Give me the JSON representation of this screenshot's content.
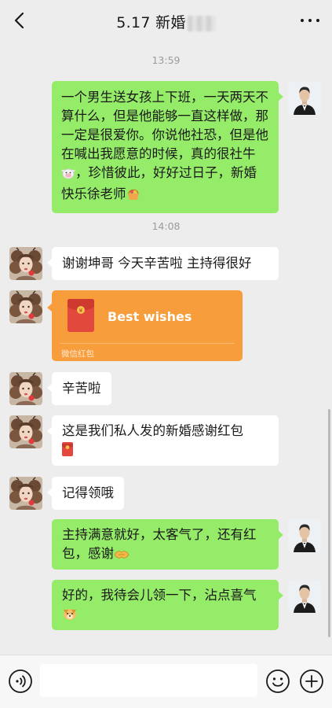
{
  "header": {
    "title": "5.17 新婚",
    "back_icon": "chevron-left-icon",
    "more_icon": "more-dots-icon"
  },
  "timestamps": [
    "13:59",
    "14:08"
  ],
  "messages": [
    {
      "sender": "me",
      "text": "一个男生送女孩上下班，一天两天不算什么，但是他能够一直这样做，那一定是很爱你。你说他社恐，但是他在喊出我愿意的时候，真的很社牛",
      "emoji": "cow-face-icon",
      "text2": "，珍惜彼此，好好过日子，新婚快乐徐老师",
      "emoji2": "gift-basket-icon"
    },
    {
      "sender": "them",
      "text": "谢谢坤哥 今天辛苦啦 主持得很好"
    },
    {
      "sender": "them",
      "type": "red_packet",
      "title": "Best wishes",
      "footer": "微信红包"
    },
    {
      "sender": "them",
      "text": "辛苦啦"
    },
    {
      "sender": "them",
      "text": "这是我们私人发的新婚感谢红包",
      "emoji": "red-envelope-icon"
    },
    {
      "sender": "them",
      "text": "记得领哦"
    },
    {
      "sender": "me",
      "text": "主持满意就好，太客气了，还有红包，感谢",
      "emoji": "handshake-icon"
    },
    {
      "sender": "me",
      "text": "好的，我待会儿领一下，沾点喜气",
      "emoji": "dog-face-icon"
    }
  ],
  "colors": {
    "my_bubble": "#95ec69",
    "their_bubble": "#ffffff",
    "red_packet": "#f89d3b",
    "background": "#ededed"
  },
  "input_bar": {
    "voice_icon": "voice-icon",
    "emoji_icon": "smiley-icon",
    "plus_icon": "plus-circle-icon",
    "placeholder": ""
  }
}
